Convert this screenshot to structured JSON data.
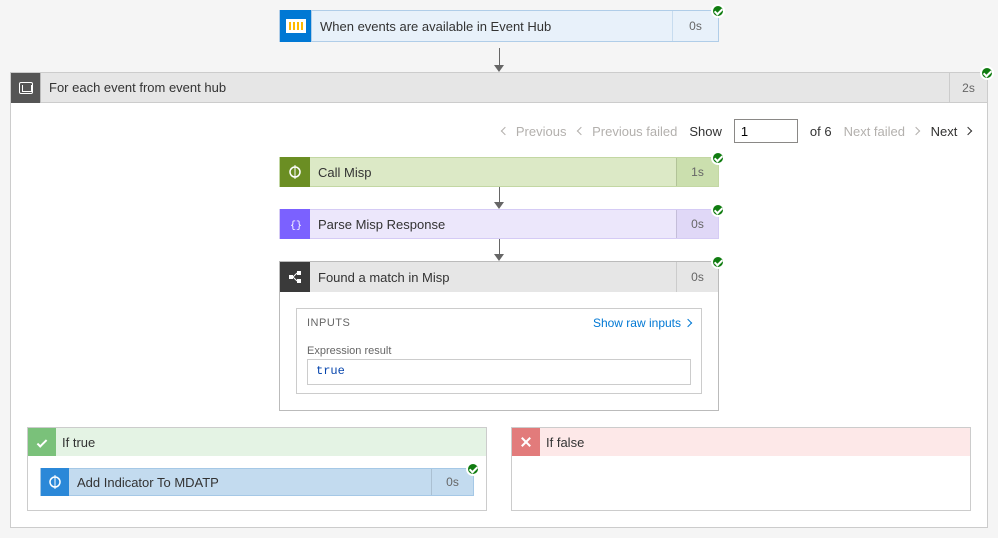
{
  "trigger": {
    "label": "When events are available in Event Hub",
    "duration": "0s"
  },
  "foreach": {
    "label": "For each event from event hub",
    "duration": "2s",
    "pager": {
      "previous": "Previous",
      "previous_failed": "Previous failed",
      "show_label": "Show",
      "current": "1",
      "of_label": "of 6",
      "next_failed": "Next failed",
      "next": "Next"
    },
    "steps": {
      "call_misp": {
        "label": "Call Misp",
        "duration": "1s"
      },
      "parse_misp": {
        "label": "Parse Misp Response",
        "duration": "0s"
      },
      "condition": {
        "label": "Found a match in Misp",
        "duration": "0s",
        "inputs_title": "INPUTS",
        "show_raw": "Show raw inputs",
        "expr_label": "Expression result",
        "expr_value": "true"
      }
    },
    "branches": {
      "true": {
        "label": "If true",
        "action": {
          "label": "Add Indicator To MDATP",
          "duration": "0s"
        }
      },
      "false": {
        "label": "If false"
      }
    }
  }
}
